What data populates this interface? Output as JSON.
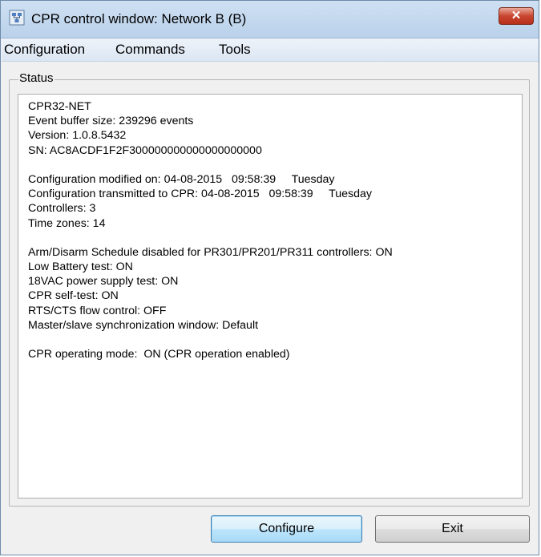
{
  "window": {
    "title": "CPR control window: Network B (B)",
    "close_glyph": "✕"
  },
  "menu": {
    "items": [
      "Configuration",
      "Commands",
      "Tools"
    ]
  },
  "status": {
    "group_label": "Status",
    "lines": [
      "CPR32-NET",
      "Event buffer size: 239296 events",
      "Version: 1.0.8.5432",
      "SN: AC8ACDF1F2F300000000000000000000",
      "",
      "Configuration modified on: 04-08-2015   09:58:39     Tuesday",
      "Configuration transmitted to CPR: 04-08-2015   09:58:39     Tuesday",
      "Controllers: 3",
      "Time zones: 14",
      "",
      "Arm/Disarm Schedule disabled for PR301/PR201/PR311 controllers: ON",
      "Low Battery test: ON",
      "18VAC power supply test: ON",
      "CPR self-test: ON",
      "RTS/CTS flow control: OFF",
      "Master/slave synchronization window: Default",
      "",
      "CPR operating mode:  ON (CPR operation enabled)"
    ]
  },
  "buttons": {
    "configure": "Configure",
    "exit": "Exit"
  },
  "icons": {
    "app": "network-app-icon",
    "close": "close-icon"
  },
  "colors": {
    "titlebar": "#c4d9ef",
    "close_button": "#c8452f",
    "default_button_border": "#3c7fb1"
  }
}
